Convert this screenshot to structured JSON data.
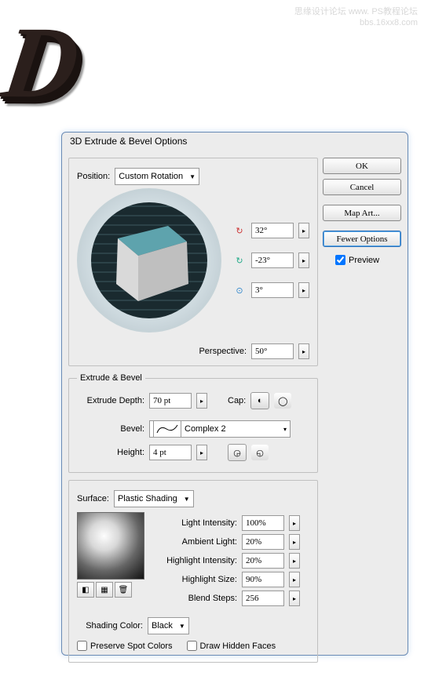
{
  "watermark": {
    "line1": "思缘设计论坛 www.",
    "line2": "PS教程论坛",
    "line3": "bbs.16xx8.com"
  },
  "dialog": {
    "title": "3D Extrude & Bevel Options",
    "buttons": {
      "ok": "OK",
      "cancel": "Cancel",
      "mapart": "Map Art...",
      "feweropts": "Fewer Options"
    },
    "preview_label": "Preview",
    "position": {
      "label": "Position:",
      "mode": "Custom Rotation",
      "rot_x": "32°",
      "rot_y": "-23°",
      "rot_z": "3°",
      "perspective_label": "Perspective:",
      "perspective": "50°"
    },
    "extrude": {
      "legend": "Extrude & Bevel",
      "depth_label": "Extrude Depth:",
      "depth": "70 pt",
      "cap_label": "Cap:",
      "bevel_label": "Bevel:",
      "bevel_name": "Complex 2",
      "height_label": "Height:",
      "height": "4 pt"
    },
    "surface": {
      "label": "Surface:",
      "mode": "Plastic Shading",
      "light_intensity_label": "Light Intensity:",
      "light_intensity": "100%",
      "ambient_label": "Ambient Light:",
      "ambient": "20%",
      "highlight_intensity_label": "Highlight Intensity:",
      "highlight_intensity": "20%",
      "highlight_size_label": "Highlight Size:",
      "highlight_size": "90%",
      "blend_steps_label": "Blend Steps:",
      "blend_steps": "256",
      "shading_color_label": "Shading Color:",
      "shading_color": "Black",
      "preserve_spot": "Preserve Spot Colors",
      "draw_hidden": "Draw Hidden Faces"
    }
  }
}
